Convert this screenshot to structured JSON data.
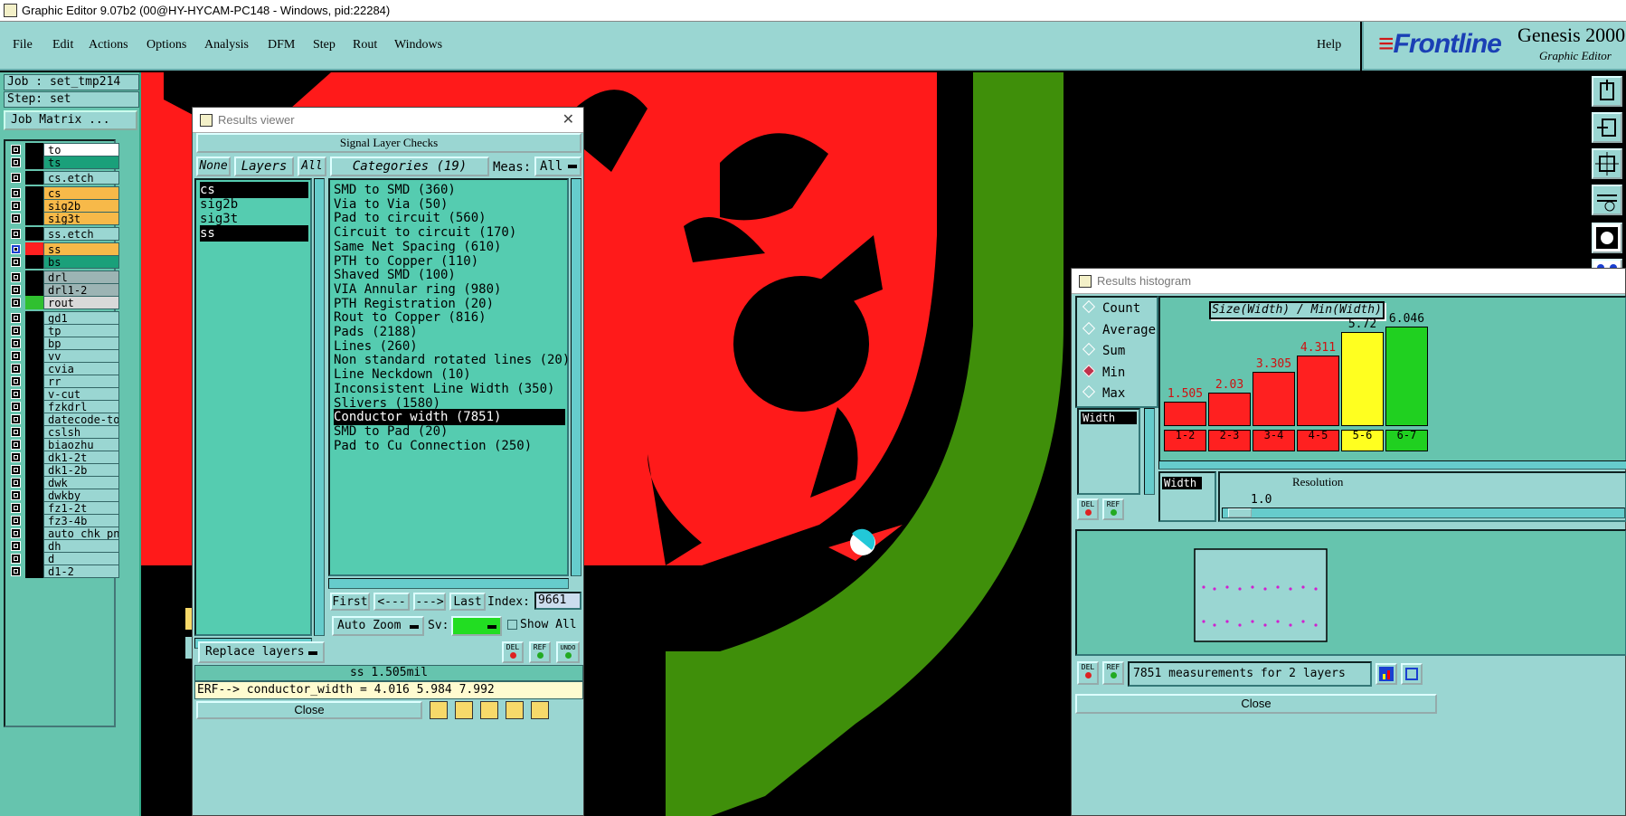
{
  "window": {
    "title": "Graphic Editor 9.07b2 (00@HY-HYCAM-PC148 - Windows, pid:22284)"
  },
  "menu": {
    "items": [
      "File",
      "Edit",
      "Actions",
      "Options",
      "Analysis",
      "DFM",
      "Step",
      "Rout",
      "Windows"
    ],
    "help": "Help"
  },
  "brand": {
    "logo_a": "Front",
    "logo_b": "line",
    "product": "Genesis 2000",
    "subtitle": "Graphic Editor"
  },
  "job": {
    "job_line": "Job : set_tmp214",
    "step_line": "Step: set",
    "matrix_button": "Job Matrix ..."
  },
  "layers": [
    {
      "name": "to",
      "color": "#ffffff"
    },
    {
      "name": "ts",
      "color": "#1aa07a"
    },
    {
      "name": "cs.etch",
      "color": "#9ad6d2"
    },
    {
      "name": "cs",
      "color": "#f7b949"
    },
    {
      "name": "sig2b",
      "color": "#f7b949"
    },
    {
      "name": "sig3t",
      "color": "#f7b949"
    },
    {
      "name": "ss.etch",
      "color": "#9ad6d2"
    },
    {
      "name": "ss",
      "color": "#f7b949",
      "swatch": "#ff2020"
    },
    {
      "name": "bs",
      "color": "#1aa07a"
    },
    {
      "name": "drl",
      "color": "#9cb4b4"
    },
    {
      "name": "drl1-2",
      "color": "#9cb4b4"
    },
    {
      "name": "rout",
      "color": "#d9d9d9",
      "swatch": "#30c030"
    },
    {
      "name": "gd1",
      "color": "#9ad6d2"
    },
    {
      "name": "tp",
      "color": "#9ad6d2"
    },
    {
      "name": "bp",
      "color": "#9ad6d2"
    },
    {
      "name": "vv",
      "color": "#9ad6d2"
    },
    {
      "name": "cvia",
      "color": "#9ad6d2"
    },
    {
      "name": "rr",
      "color": "#9ad6d2"
    },
    {
      "name": "v-cut",
      "color": "#9ad6d2"
    },
    {
      "name": "fzkdrl",
      "color": "#9ad6d2"
    },
    {
      "name": "datecode-to",
      "color": "#9ad6d2"
    },
    {
      "name": "cslsh",
      "color": "#9ad6d2"
    },
    {
      "name": "biaozhu",
      "color": "#9ad6d2"
    },
    {
      "name": "dk1-2t",
      "color": "#9ad6d2"
    },
    {
      "name": "dk1-2b",
      "color": "#9ad6d2"
    },
    {
      "name": "dwk",
      "color": "#9ad6d2"
    },
    {
      "name": "dwkby",
      "color": "#9ad6d2"
    },
    {
      "name": "fz1-2t",
      "color": "#9ad6d2"
    },
    {
      "name": "fz3-4b",
      "color": "#9ad6d2"
    },
    {
      "name": "auto_chk_pn",
      "color": "#9ad6d2"
    },
    {
      "name": "dh",
      "color": "#9ad6d2"
    },
    {
      "name": "d",
      "color": "#9ad6d2"
    },
    {
      "name": "d1-2",
      "color": "#9ad6d2"
    }
  ],
  "results_viewer": {
    "title": "Results viewer",
    "header": "Signal Layer Checks",
    "none": "None",
    "layers": "Layers",
    "all": "All",
    "categories_btn": "Categories (19)",
    "meas_label": "Meas:",
    "meas_value": "All",
    "layer_list": [
      "cs",
      "sig2b",
      "sig3t",
      "ss"
    ],
    "categories": [
      "SMD to SMD (360)",
      "Via to Via (50)",
      "Pad to circuit (560)",
      "Circuit to circuit (170)",
      "Same Net Spacing (610)",
      "PTH to Copper (110)",
      "Shaved SMD (100)",
      "VIA Annular ring (980)",
      "PTH Registration (20)",
      "Rout to Copper (816)",
      "Pads (2188)",
      "Lines (260)",
      "Non standard rotated lines (20)",
      "Line Neckdown (10)",
      "Inconsistent Line Width (350)",
      "Slivers (1580)",
      "Conductor width (7851)",
      "SMD to Pad (20)",
      "Pad to Cu Connection (250)"
    ],
    "selected_category": "Conductor width (7851)",
    "nav": {
      "first": "First",
      "prev": "<---",
      "next": "--->",
      "last": "Last",
      "index_label": "Index:",
      "index_value": "9661"
    },
    "auto_zoom": "Auto Zoom",
    "sv_label": "Sv:",
    "show_all": "Show All",
    "replace_layers": "Replace layers",
    "tool_del": "DEL",
    "tool_ref": "REF",
    "tool_undo": "UNDO",
    "status": "ss 1.505mil",
    "erf": "ERF--> conductor_width = 4.016 5.984 7.992",
    "close": "Close"
  },
  "histogram": {
    "title": "Results histogram",
    "modes": [
      "Count",
      "Average",
      "Sum",
      "Min",
      "Max"
    ],
    "selected_mode": "Min",
    "chart_title": "Size(Width) / Min(Width)",
    "field": "Width",
    "field2": "Width",
    "resolution_label": "Resolution",
    "resolution_value": "1.0",
    "del": "DEL",
    "ref": "REF",
    "summary": "7851 measurements for 2 layers",
    "close": "Close"
  },
  "chart_data": {
    "type": "bar",
    "categories": [
      "1-2",
      "2-3",
      "3-4",
      "4-5",
      "5-6",
      "6-7"
    ],
    "values": [
      1.505,
      2.03,
      3.305,
      4.311,
      5.72,
      6.046
    ],
    "labels": [
      "1.505",
      "2.03",
      "3.305",
      "4.311",
      "5.72",
      "6.046"
    ],
    "colors": [
      "#ff2020",
      "#ff2020",
      "#ff2020",
      "#ff2020",
      "#ffff20",
      "#20d020"
    ],
    "title": "Size(Width) / Min(Width)",
    "ylim": [
      0,
      6.5
    ]
  }
}
